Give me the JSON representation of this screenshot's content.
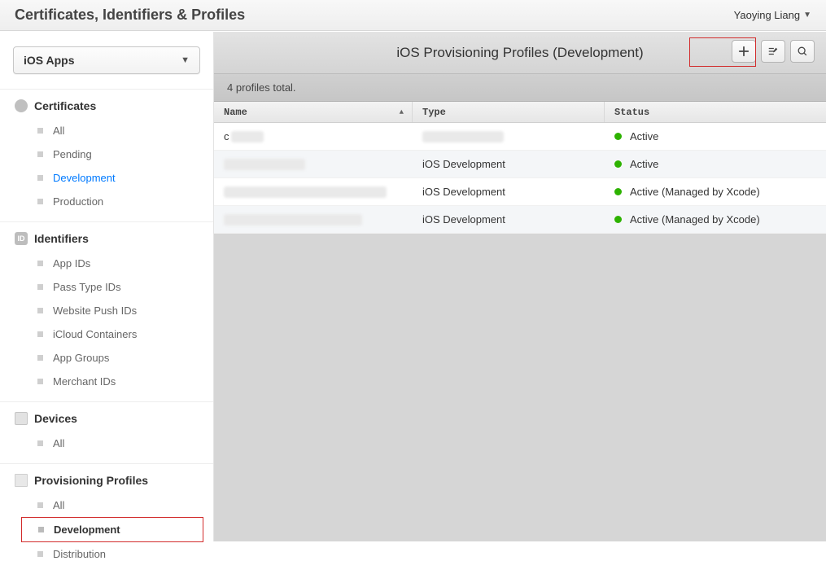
{
  "header": {
    "title": "Certificates, Identifiers & Profiles",
    "user_name": "Yaoying Liang"
  },
  "sidebar": {
    "platform_label": "iOS Apps",
    "sections": [
      {
        "title": "Certificates",
        "icon": "certificates",
        "items": [
          {
            "label": "All",
            "state": ""
          },
          {
            "label": "Pending",
            "state": ""
          },
          {
            "label": "Development",
            "state": "active-link"
          },
          {
            "label": "Production",
            "state": ""
          }
        ]
      },
      {
        "title": "Identifiers",
        "icon": "identifiers",
        "items": [
          {
            "label": "App IDs",
            "state": ""
          },
          {
            "label": "Pass Type IDs",
            "state": ""
          },
          {
            "label": "Website Push IDs",
            "state": ""
          },
          {
            "label": "iCloud Containers",
            "state": ""
          },
          {
            "label": "App Groups",
            "state": ""
          },
          {
            "label": "Merchant IDs",
            "state": ""
          }
        ]
      },
      {
        "title": "Devices",
        "icon": "devices",
        "items": [
          {
            "label": "All",
            "state": ""
          }
        ]
      },
      {
        "title": "Provisioning Profiles",
        "icon": "profiles",
        "items": [
          {
            "label": "All",
            "state": ""
          },
          {
            "label": "Development",
            "state": "selected"
          },
          {
            "label": "Distribution",
            "state": ""
          }
        ]
      }
    ]
  },
  "main": {
    "title": "iOS Provisioning Profiles (Development)",
    "count_text": "4 profiles total.",
    "columns": {
      "name": "Name",
      "type": "Type",
      "status": "Status"
    },
    "rows": [
      {
        "name": "c",
        "name_redacted": "w40",
        "type": "",
        "type_redacted": "w100",
        "status": "Active",
        "status_color": "#2db200"
      },
      {
        "name": "",
        "name_redacted": "w100",
        "type": "iOS Development",
        "type_redacted": "",
        "status": "Active",
        "status_color": "#2db200"
      },
      {
        "name": "",
        "name_redacted": "w200",
        "type": "iOS Development",
        "type_redacted": "",
        "status": "Active (Managed by Xcode)",
        "status_color": "#2db200"
      },
      {
        "name": "",
        "name_redacted": "w170",
        "type": "iOS Development",
        "type_redacted": "",
        "status": "Active (Managed by Xcode)",
        "status_color": "#2db200"
      }
    ]
  }
}
